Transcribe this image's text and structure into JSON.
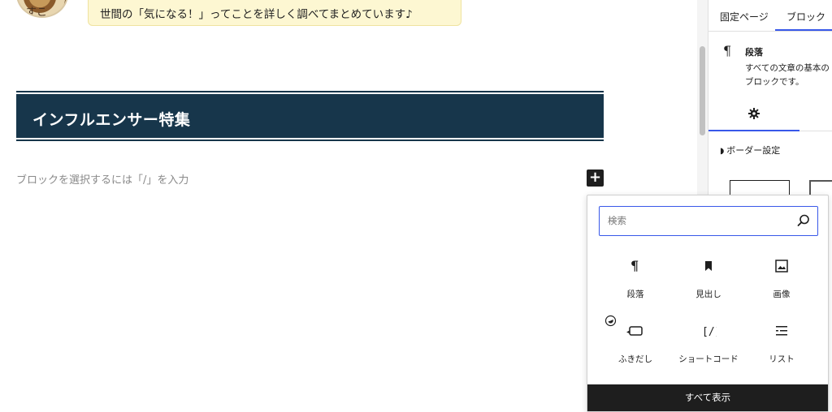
{
  "content": {
    "bubble_text": "世間の「気になる！」ってことを詳しく調べてまとめています♪",
    "avatar_alt_text": "すこ",
    "heading": "インフルエンサー特集",
    "placeholder": "ブロックを選択するには「/」を入力",
    "inserter_toggle": "+"
  },
  "sidebar": {
    "tabs": [
      {
        "label": "固定ページ",
        "active": false
      },
      {
        "label": "ブロック",
        "active": true
      }
    ],
    "block": {
      "icon": "paragraph-icon",
      "name": "段落",
      "description": "すべての文章の基本のブロックです。"
    },
    "settings_icon": "gear-icon",
    "border_setting_label": "ボーダー設定"
  },
  "inserter": {
    "search_placeholder": "検索",
    "search_value": "",
    "items": [
      {
        "label": "段落",
        "icon": "paragraph-icon"
      },
      {
        "label": "見出し",
        "icon": "bookmark-icon"
      },
      {
        "label": "画像",
        "icon": "image-icon"
      },
      {
        "label": "ふきだし",
        "icon": "speech-bubble-icon"
      },
      {
        "label": "ショートコード",
        "icon": "shortcode-icon"
      },
      {
        "label": "リスト",
        "icon": "list-icon"
      }
    ],
    "show_all_label": "すべて表示"
  },
  "colors": {
    "heading_bg": "#17364b",
    "accent": "#3858e9",
    "bubble_bg": "#fdf7d2",
    "dark": "#1e1e1e"
  }
}
